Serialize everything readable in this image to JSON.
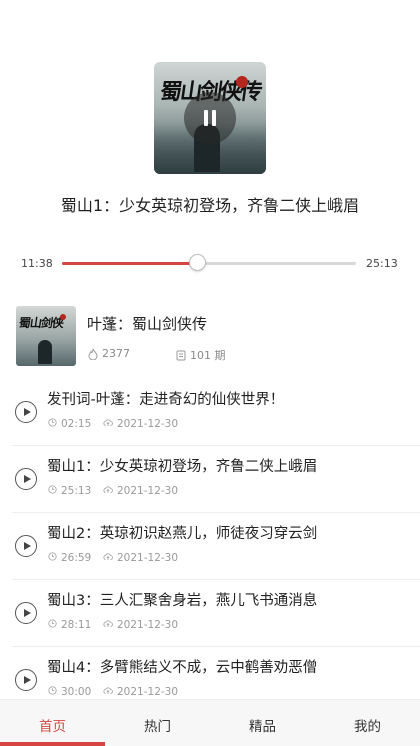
{
  "player": {
    "track_title": "蜀山1：少女英琼初登场，齐鲁二侠上峨眉",
    "state": "playing",
    "current_time": "11:38",
    "total_time": "25:13",
    "progress": 0.46,
    "cover_icon": "album-cover-art"
  },
  "album": {
    "name": "叶蓬：蜀山剑侠传",
    "plays": "2377",
    "episodes": "101 期",
    "plays_icon": "flame-icon",
    "episodes_icon": "list-icon"
  },
  "episodes": [
    {
      "title": "发刊词-叶蓬：走进奇幻的仙侠世界！",
      "duration": "02:15",
      "date": "2021-12-30"
    },
    {
      "title": "蜀山1：少女英琼初登场，齐鲁二侠上峨眉",
      "duration": "25:13",
      "date": "2021-12-30"
    },
    {
      "title": "蜀山2：英琼初识赵燕儿，师徒夜习穿云剑",
      "duration": "26:59",
      "date": "2021-12-30"
    },
    {
      "title": "蜀山3：三人汇聚舍身岩，燕儿飞书通消息",
      "duration": "28:11",
      "date": "2021-12-30"
    },
    {
      "title": "蜀山4：多臂熊结义不成，云中鹤善劝恶僧",
      "duration": "30:00",
      "date": "2021-12-30"
    }
  ],
  "nav": {
    "items": [
      "首页",
      "热门",
      "精品",
      "我的"
    ],
    "active": 0,
    "accent_color": "#d64541"
  }
}
